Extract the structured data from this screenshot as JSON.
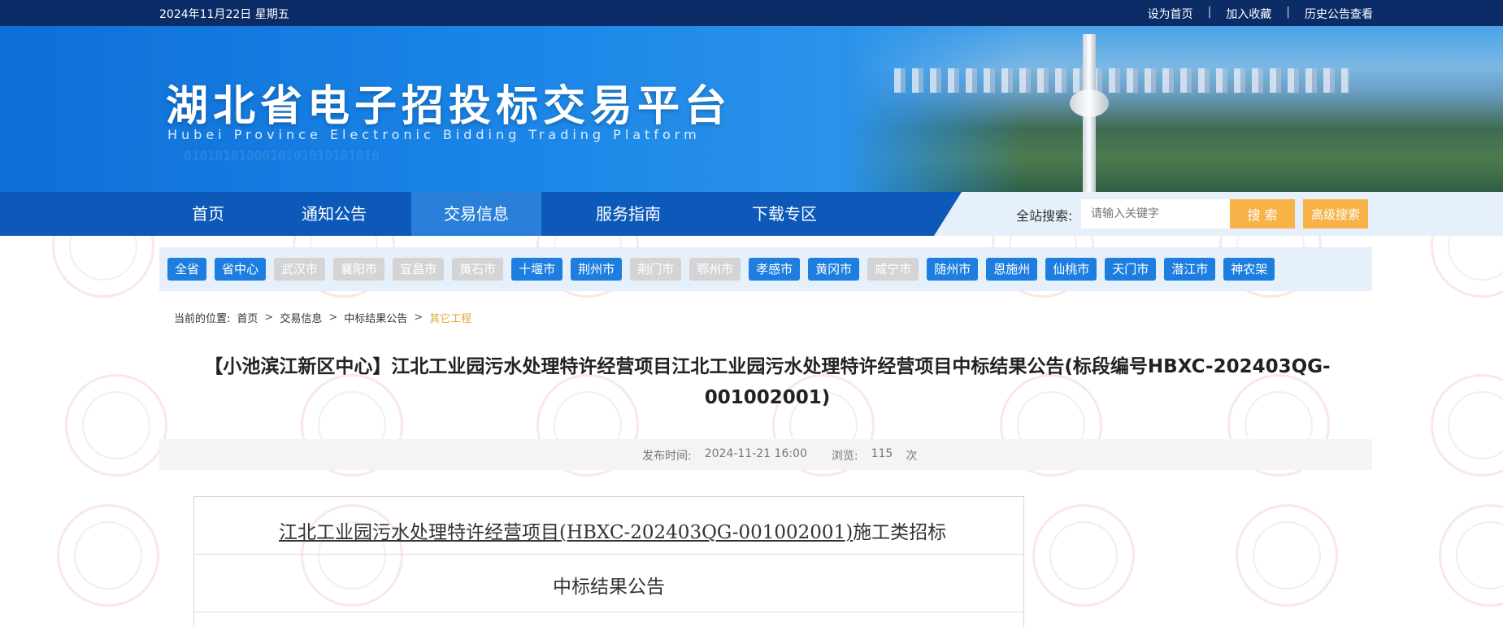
{
  "topbar": {
    "date": "2024年11月22日 星期五",
    "links": [
      "设为首页",
      "加入收藏",
      "历史公告查看"
    ],
    "separator": "|"
  },
  "brand": {
    "title": "湖北省电子招投标交易平台",
    "subtitle": "Hubei Province Electronic Bidding Trading Platform"
  },
  "nav": {
    "items": [
      "首页",
      "通知公告",
      "交易信息",
      "服务指南",
      "下载专区"
    ],
    "active": "交易信息"
  },
  "search": {
    "label": "全站搜索:",
    "placeholder": "请输入关键字",
    "button": "搜 索",
    "advanced": "高级搜索"
  },
  "cities": [
    {
      "name": "全省",
      "enabled": true
    },
    {
      "name": "省中心",
      "enabled": true
    },
    {
      "name": "武汉市",
      "enabled": false
    },
    {
      "name": "襄阳市",
      "enabled": false
    },
    {
      "name": "宜昌市",
      "enabled": false
    },
    {
      "name": "黄石市",
      "enabled": false
    },
    {
      "name": "十堰市",
      "enabled": true
    },
    {
      "name": "荆州市",
      "enabled": true
    },
    {
      "name": "荆门市",
      "enabled": false
    },
    {
      "name": "鄂州市",
      "enabled": false
    },
    {
      "name": "孝感市",
      "enabled": true
    },
    {
      "name": "黄冈市",
      "enabled": true
    },
    {
      "name": "咸宁市",
      "enabled": false
    },
    {
      "name": "随州市",
      "enabled": true
    },
    {
      "name": "恩施州",
      "enabled": true
    },
    {
      "name": "仙桃市",
      "enabled": true
    },
    {
      "name": "天门市",
      "enabled": true
    },
    {
      "name": "潜江市",
      "enabled": true
    },
    {
      "name": "神农架",
      "enabled": true
    }
  ],
  "breadcrumb": {
    "label": "当前的位置:",
    "items": [
      "首页",
      "交易信息",
      "中标结果公告"
    ],
    "current": "其它工程"
  },
  "article": {
    "title": "【小池滨江新区中心】江北工业园污水处理特许经营项目江北工业园污水处理特许经营项目中标结果公告(标段编号HBXC-202403QG-001002001)",
    "publish_label": "发布时间:",
    "publish_time": "2024-11-21 16:00",
    "views_label": "浏览:",
    "views": "115",
    "views_unit": "次",
    "doc_line_underlined": "江北工业园污水处理特许经营项目(HBXC-202403QG-001002001)",
    "doc_line_suffix": "施工类招标",
    "doc_heading": "中标结果公告"
  },
  "colors": {
    "topbar": "#0b2c66",
    "nav": "#0c59b9",
    "nav_active": "#2a80d8",
    "city_on": "#1e7ee0",
    "city_off": "#d4d4d4",
    "search_button": "#f7b347",
    "breadcrumb_current": "#e8a534"
  }
}
